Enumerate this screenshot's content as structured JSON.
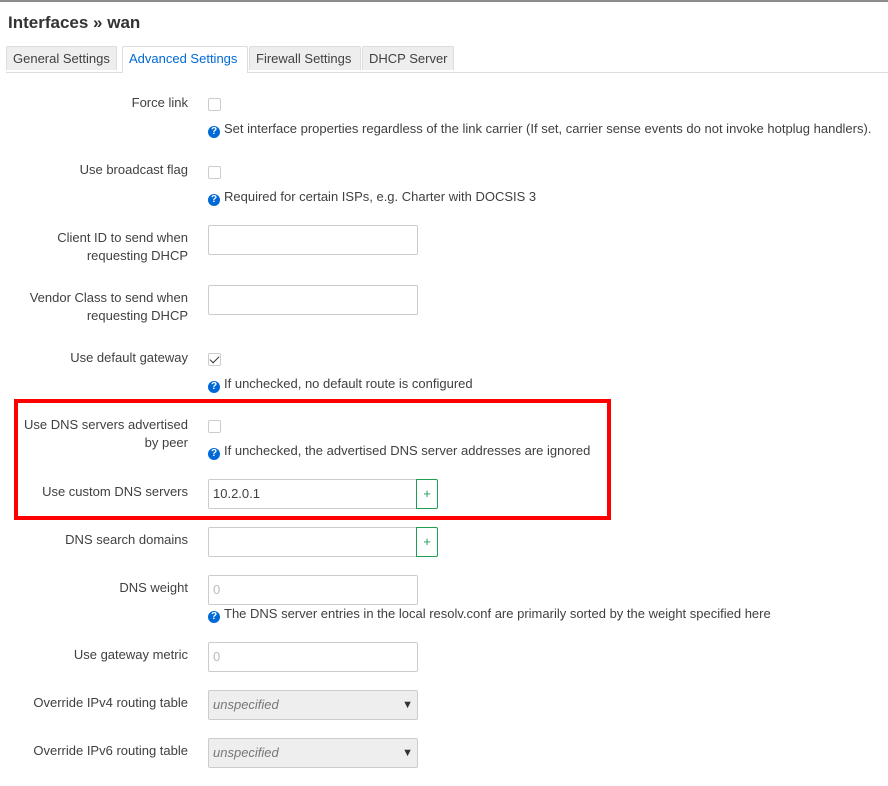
{
  "page": {
    "title": "Interfaces » wan"
  },
  "tabs": [
    {
      "label": "General Settings",
      "active": false
    },
    {
      "label": "Advanced Settings",
      "active": true
    },
    {
      "label": "Firewall Settings",
      "active": false
    },
    {
      "label": "DHCP Server",
      "active": false
    }
  ],
  "fields": {
    "force_link": {
      "label": "Force link",
      "checked": false,
      "help": "Set interface properties regardless of the link carrier (If set, carrier sense events do not invoke hotplug handlers)."
    },
    "broadcast_flag": {
      "label": "Use broadcast flag",
      "checked": false,
      "help": "Required for certain ISPs, e.g. Charter with DOCSIS 3"
    },
    "client_id": {
      "label_line1": "Client ID to send when",
      "label_line2": "requesting DHCP",
      "value": ""
    },
    "vendor_class": {
      "label_line1": "Vendor Class to send when",
      "label_line2": "requesting DHCP",
      "value": ""
    },
    "default_gateway": {
      "label": "Use default gateway",
      "checked": true,
      "help": "If unchecked, no default route is configured"
    },
    "peer_dns": {
      "label_line1": "Use DNS servers advertised",
      "label_line2": "by peer",
      "checked": false,
      "help": "If unchecked, the advertised DNS server addresses are ignored"
    },
    "custom_dns": {
      "label": "Use custom DNS servers",
      "value": "10.2.0.1",
      "add_label": "+"
    },
    "dns_search": {
      "label": "DNS search domains",
      "value": "",
      "add_label": "+"
    },
    "dns_weight": {
      "label": "DNS weight",
      "placeholder": "0",
      "help": "The DNS server entries in the local resolv.conf are primarily sorted by the weight specified here"
    },
    "gateway_metric": {
      "label": "Use gateway metric",
      "placeholder": "0"
    },
    "ipv4_table": {
      "label": "Override IPv4 routing table",
      "value": "unspecified"
    },
    "ipv6_table": {
      "label": "Override IPv6 routing table",
      "value": "unspecified"
    }
  },
  "help_icon": "question-circle-icon",
  "highlight_color": "#ff0000",
  "accent_color": "#0069d6"
}
